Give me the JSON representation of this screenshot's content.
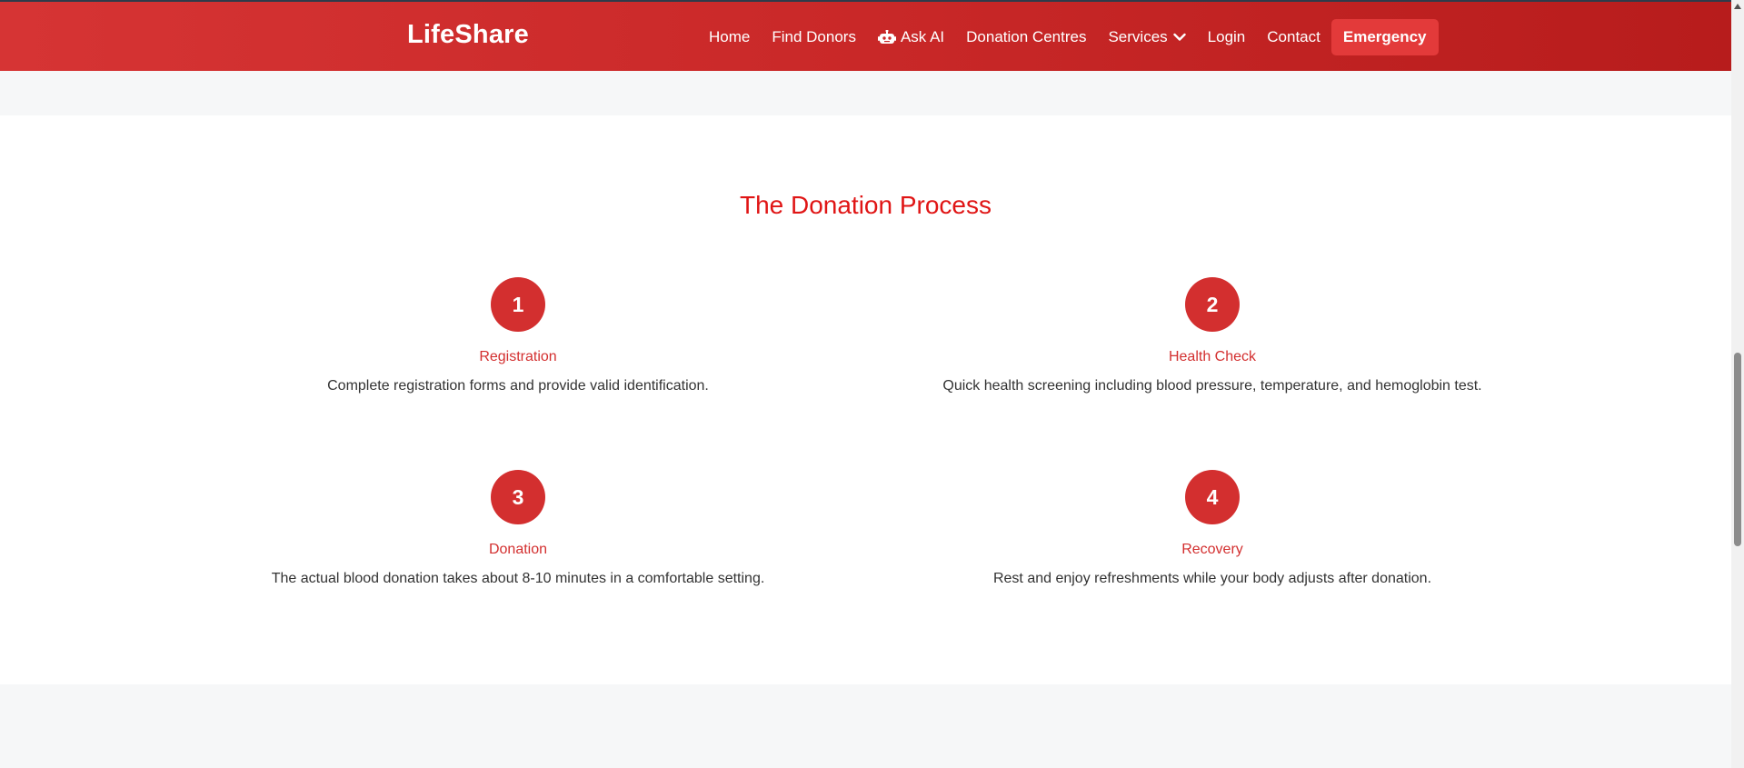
{
  "navbar": {
    "brand": "LifeShare",
    "links": [
      {
        "label": "Home"
      },
      {
        "label": "Find Donors"
      },
      {
        "label": "Ask AI",
        "icon": "robot-icon"
      },
      {
        "label": "Donation Centres"
      },
      {
        "label": "Services",
        "icon": "chevron-down-icon"
      },
      {
        "label": "Login"
      },
      {
        "label": "Contact"
      }
    ],
    "emergency_label": "Emergency"
  },
  "process": {
    "title": "The Donation Process",
    "steps": [
      {
        "number": "1",
        "title": "Registration",
        "description": "Complete registration forms and provide valid identification."
      },
      {
        "number": "2",
        "title": "Health Check",
        "description": "Quick health screening including blood pressure, temperature, and hemoglobin test."
      },
      {
        "number": "3",
        "title": "Donation",
        "description": "The actual blood donation takes about 8-10 minutes in a comfortable setting."
      },
      {
        "number": "4",
        "title": "Recovery",
        "description": "Rest and enjoy refreshments while your body adjusts after donation."
      }
    ]
  },
  "colors": {
    "navbar": "#d32f2f",
    "accent": "#d32f2f",
    "title": "#e01515",
    "emergency": "#e33a3a"
  }
}
